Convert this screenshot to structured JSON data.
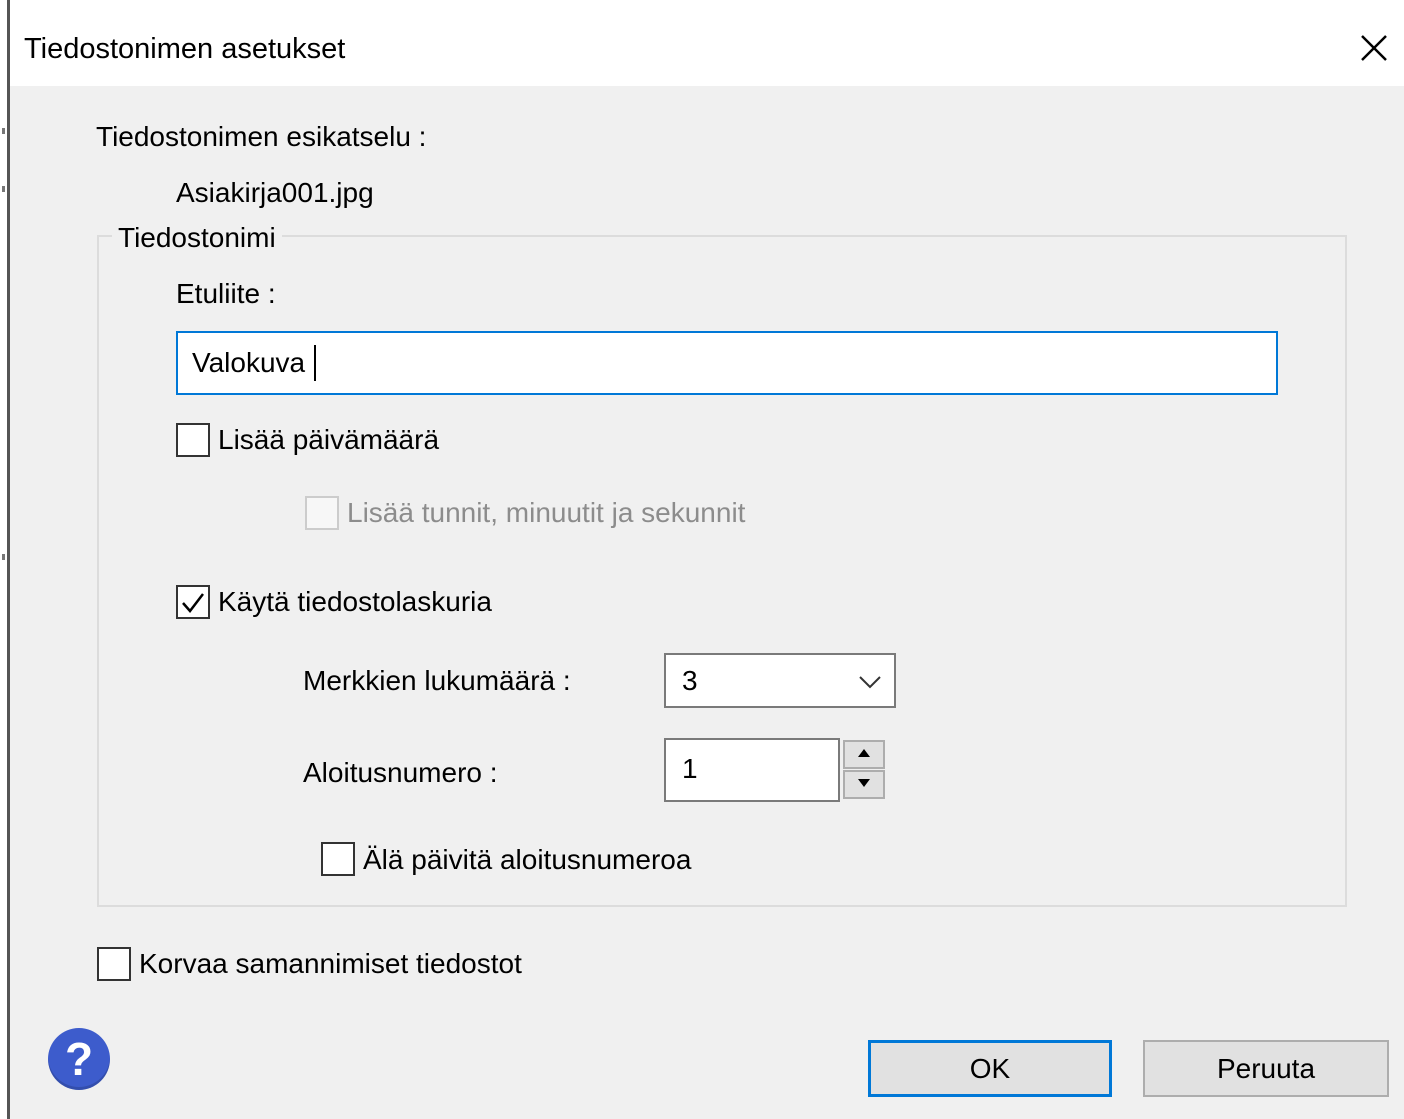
{
  "dialog": {
    "title": "Tiedostonimen asetukset",
    "preview_label": "Tiedostonimen esikatselu :",
    "preview_value": "Asiakirja001.jpg"
  },
  "filename_group": {
    "legend": "Tiedostonimi",
    "prefix_label": "Etuliite  :",
    "prefix_value": "Valokuva",
    "add_date": {
      "label": "Lisää päivämäärä",
      "checked": false
    },
    "add_time": {
      "label": "Lisää tunnit, minuutit ja sekunnit",
      "checked": false,
      "disabled": true
    },
    "use_counter": {
      "label": "Käytä tiedostolaskuria",
      "checked": true
    },
    "digits_label": "Merkkien lukumäärä  :",
    "digits_value": "3",
    "start_number_label": "Aloitusnumero  :",
    "start_number_value": "1",
    "dont_update": {
      "label": "Älä päivitä aloitusnumeroa",
      "checked": false
    }
  },
  "overwrite": {
    "label": "Korvaa samannimiset tiedostot",
    "checked": false
  },
  "buttons": {
    "ok": "OK",
    "cancel": "Peruuta"
  },
  "icons": {
    "help": "help-icon",
    "close": "close-icon",
    "dropdown": "chevron-down-icon",
    "spin_up": "spin-up-icon",
    "spin_down": "spin-down-icon",
    "check": "checkmark-icon"
  },
  "colors": {
    "focus_border": "#0078d7",
    "help_icon": "#3d5ccc",
    "dialog_bg": "#f0f0f0"
  }
}
